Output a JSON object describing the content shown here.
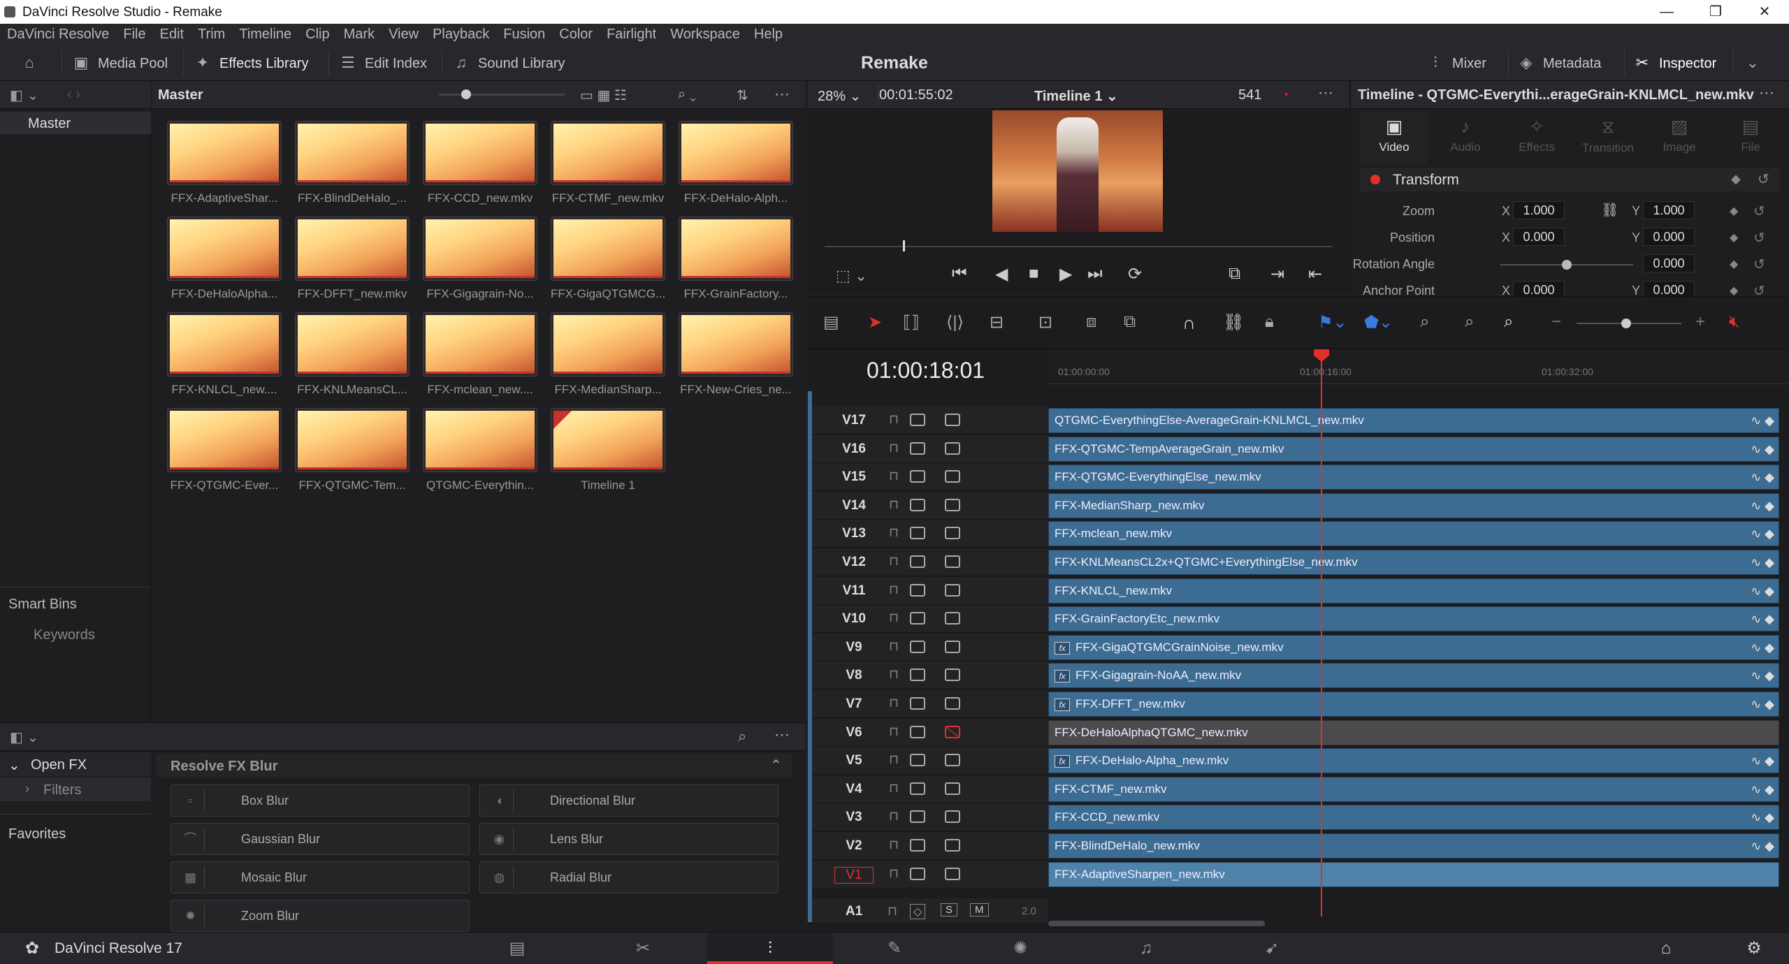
{
  "window": {
    "title": "DaVinci Resolve Studio - Remake"
  },
  "menu": [
    "DaVinci Resolve",
    "File",
    "Edit",
    "Trim",
    "Timeline",
    "Clip",
    "Mark",
    "View",
    "Playback",
    "Fusion",
    "Color",
    "Fairlight",
    "Workspace",
    "Help"
  ],
  "toolbar": {
    "media_pool": "Media Pool",
    "effects_library": "Effects Library",
    "edit_index": "Edit Index",
    "sound_library": "Sound Library",
    "project": "Remake",
    "mixer": "Mixer",
    "metadata": "Metadata",
    "inspector": "Inspector"
  },
  "bins": {
    "master": "Master",
    "smart_bins": "Smart Bins",
    "keywords": "Keywords"
  },
  "pool": {
    "header": "Master",
    "clips": [
      "FFX-AdaptiveShar...",
      "FFX-BlindDeHalo_...",
      "FFX-CCD_new.mkv",
      "FFX-CTMF_new.mkv",
      "FFX-DeHalo-Alph...",
      "FFX-DeHaloAlpha...",
      "FFX-DFFT_new.mkv",
      "FFX-Gigagrain-No...",
      "FFX-GigaQTGMCG...",
      "FFX-GrainFactory...",
      "FFX-KNLCL_new....",
      "FFX-KNLMeansCL...",
      "FFX-mclean_new....",
      "FFX-MedianSharp...",
      "FFX-New-Cries_ne...",
      "FFX-QTGMC-Ever...",
      "FFX-QTGMC-Tem...",
      "QTGMC-Everythin...",
      "Timeline 1"
    ]
  },
  "fx": {
    "open_fx": "Open FX",
    "filters": "Filters",
    "favorites": "Favorites",
    "category": "Resolve FX Blur",
    "items": [
      "Box Blur",
      "Directional Blur",
      "Gaussian Blur",
      "Lens Blur",
      "Mosaic Blur",
      "Radial Blur",
      "Zoom Blur"
    ]
  },
  "viewer": {
    "zoom": "28%",
    "timecode": "00:01:55:02",
    "timeline_name": "Timeline 1",
    "frame": "541"
  },
  "timeline": {
    "timecode": "01:00:18:01",
    "ruler": [
      "01:00:00:00",
      "01:00:16:00",
      "01:00:32:00"
    ],
    "tracks": [
      {
        "name": "V17",
        "clip": "QTGMC-EverythingElse-AverageGrain-KNLMCL_new.mkv",
        "fx": false
      },
      {
        "name": "V16",
        "clip": "FFX-QTGMC-TempAverageGrain_new.mkv",
        "fx": false
      },
      {
        "name": "V15",
        "clip": "FFX-QTGMC-EverythingElse_new.mkv",
        "fx": false
      },
      {
        "name": "V14",
        "clip": "FFX-MedianSharp_new.mkv",
        "fx": false
      },
      {
        "name": "V13",
        "clip": "FFX-mclean_new.mkv",
        "fx": false
      },
      {
        "name": "V12",
        "clip": "FFX-KNLMeansCL2x+QTGMC+EverythingElse_new.mkv",
        "fx": false
      },
      {
        "name": "V11",
        "clip": "FFX-KNLCL_new.mkv",
        "fx": false
      },
      {
        "name": "V10",
        "clip": "FFX-GrainFactoryEtc_new.mkv",
        "fx": false
      },
      {
        "name": "V9",
        "clip": "FFX-GigaQTGMCGrainNoise_new.mkv",
        "fx": true
      },
      {
        "name": "V8",
        "clip": "FFX-Gigagrain-NoAA_new.mkv",
        "fx": true
      },
      {
        "name": "V7",
        "clip": "FFX-DFFT_new.mkv",
        "fx": true
      },
      {
        "name": "V6",
        "clip": "FFX-DeHaloAlphaQTGMC_new.mkv",
        "fx": false
      },
      {
        "name": "V5",
        "clip": "FFX-DeHalo-Alpha_new.mkv",
        "fx": true
      },
      {
        "name": "V4",
        "clip": "FFX-CTMF_new.mkv",
        "fx": false
      },
      {
        "name": "V3",
        "clip": "FFX-CCD_new.mkv",
        "fx": false
      },
      {
        "name": "V2",
        "clip": "FFX-BlindDeHalo_new.mkv",
        "fx": false
      },
      {
        "name": "V1",
        "clip": "FFX-AdaptiveSharpen_new.mkv",
        "fx": false
      }
    ],
    "audio_track": "A1",
    "audio_level": "2.0"
  },
  "inspector": {
    "title": "Timeline - QTGMC-Everythi...erageGrain-KNLMCL_new.mkv",
    "tabs": [
      "Video",
      "Audio",
      "Effects",
      "Transition",
      "Image",
      "File"
    ],
    "section": "Transform",
    "zoom_label": "Zoom",
    "zoom_x": "1.000",
    "zoom_y": "1.000",
    "position_label": "Position",
    "pos_x": "0.000",
    "pos_y": "0.000",
    "rotation_label": "Rotation Angle",
    "rotation": "0.000",
    "anchor_label": "Anchor Point",
    "anchor_x": "0.000",
    "anchor_y": "0.000",
    "x": "X",
    "y": "Y"
  },
  "footer": {
    "app": "DaVinci Resolve 17"
  },
  "colors": {
    "accent": "#e0302b",
    "clip": "#3d6c92"
  }
}
